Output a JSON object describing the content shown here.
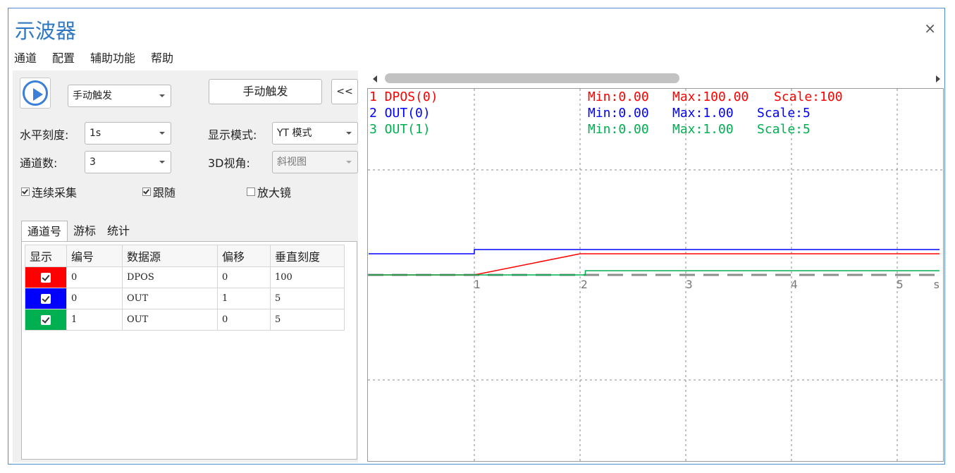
{
  "window": {
    "title": "示波器",
    "close_icon": "×"
  },
  "menu": [
    "通道",
    "配置",
    "辅助功能",
    "帮助"
  ],
  "controls": {
    "trigger_mode": "手动触发",
    "manual_trigger_button": "手动触发",
    "collapse_button": "<<",
    "h_scale_label": "水平刻度:",
    "h_scale_value": "1s",
    "display_mode_label": "显示模式:",
    "display_mode_value": "YT 模式",
    "channel_count_label": "通道数:",
    "channel_count_value": "3",
    "view3d_label": "3D视角:",
    "view3d_value": "斜视图",
    "continuous_label": "连续采集",
    "continuous_checked": true,
    "follow_label": "跟随",
    "follow_checked": true,
    "magnifier_label": "放大镜",
    "magnifier_checked": false
  },
  "tabs": [
    "通道号",
    "游标",
    "统计"
  ],
  "table": {
    "headers": [
      "显示",
      "编号",
      "数据源",
      "偏移",
      "垂直刻度"
    ],
    "rows": [
      {
        "color": "#ff0000",
        "id": "0",
        "source": "DPOS",
        "offset": "0",
        "scale": "100"
      },
      {
        "color": "#0000ff",
        "id": "0",
        "source": "OUT",
        "offset": "1",
        "scale": "5"
      },
      {
        "color": "#00b050",
        "id": "1",
        "source": "OUT",
        "offset": "0",
        "scale": "5"
      }
    ]
  },
  "scope": {
    "channels": [
      {
        "label": "1 DPOS(0)",
        "min": "Min:0.00",
        "max": "Max:100.00",
        "scale": "Scale:100",
        "color": "#ff0000"
      },
      {
        "label": "2 OUT(0)",
        "min": "Min:0.00",
        "max": "Max:1.00",
        "scale": "Scale:5",
        "color": "#0000ff"
      },
      {
        "label": "3 OUT(1)",
        "min": "Min:0.00",
        "max": "Max:1.00",
        "scale": "Scale:5",
        "color": "#00b050"
      }
    ],
    "x_ticks": [
      "1",
      "2",
      "3",
      "4",
      "5"
    ],
    "x_unit": "s"
  },
  "chart_data": {
    "type": "line",
    "x_unit": "s",
    "xlim": [
      0,
      5.4
    ],
    "series": [
      {
        "name": "1 DPOS(0)",
        "x": [
          0,
          1.0,
          2.0,
          5.4
        ],
        "y": [
          0,
          0,
          100,
          100
        ]
      },
      {
        "name": "2 OUT(0)",
        "x": [
          0,
          1.0,
          1.0,
          5.4
        ],
        "y": [
          0,
          0,
          1,
          1
        ]
      },
      {
        "name": "3 OUT(1)",
        "x": [
          0,
          2.05,
          2.05,
          5.4
        ],
        "y": [
          0,
          0,
          1,
          1
        ]
      }
    ]
  }
}
